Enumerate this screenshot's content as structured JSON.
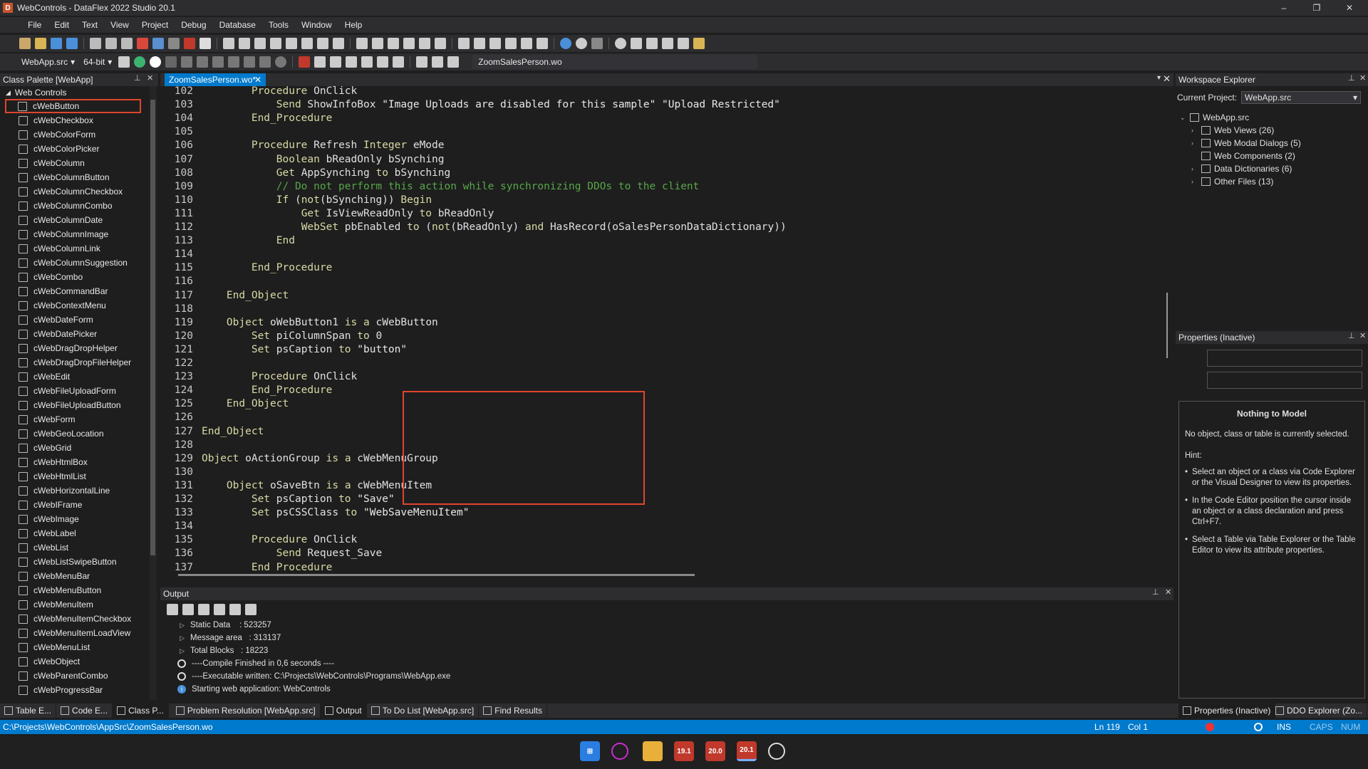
{
  "window": {
    "title": "WebControls - DataFlex 2022 Studio 20.1",
    "controls": [
      "–",
      "❐",
      "✕"
    ]
  },
  "menu": [
    "File",
    "Edit",
    "Text",
    "View",
    "Project",
    "Debug",
    "Database",
    "Tools",
    "Window",
    "Help"
  ],
  "toolbar": {
    "project_combo": "WebApp.src",
    "arch_combo": "64-bit",
    "file_field": "ZoomSalesPerson.wo"
  },
  "class_palette": {
    "title": "Class Palette [WebApp]",
    "root": "Web Controls",
    "items": [
      "cWebButton",
      "cWebCheckbox",
      "cWebColorForm",
      "cWebColorPicker",
      "cWebColumn",
      "cWebColumnButton",
      "cWebColumnCheckbox",
      "cWebColumnCombo",
      "cWebColumnDate",
      "cWebColumnImage",
      "cWebColumnLink",
      "cWebColumnSuggestion",
      "cWebCombo",
      "cWebCommandBar",
      "cWebContextMenu",
      "cWebDateForm",
      "cWebDatePicker",
      "cWebDragDropHelper",
      "cWebDragDropFileHelper",
      "cWebEdit",
      "cWebFileUploadForm",
      "cWebFileUploadButton",
      "cWebForm",
      "cWebGeoLocation",
      "cWebGrid",
      "cWebHtmlBox",
      "cWebHtmlList",
      "cWebHorizontalLine",
      "cWebIFrame",
      "cWebImage",
      "cWebLabel",
      "cWebList",
      "cWebListSwipeButton",
      "cWebMenuBar",
      "cWebMenuButton",
      "cWebMenuItem",
      "cWebMenuItemCheckbox",
      "cWebMenuItemLoadView",
      "cWebMenuList",
      "cWebObject",
      "cWebParentCombo",
      "cWebProgressBar"
    ],
    "selected_index": 0
  },
  "editor": {
    "tab_label": "ZoomSalesPerson.wo*",
    "lines": [
      {
        "n": "102",
        "t": "        Procedure OnClick"
      },
      {
        "n": "103",
        "t": "            Send ShowInfoBox \"Image Uploads are disabled for this sample\" \"Upload Restricted\""
      },
      {
        "n": "104",
        "t": "        End_Procedure"
      },
      {
        "n": "105",
        "t": ""
      },
      {
        "n": "106",
        "t": "        Procedure Refresh Integer eMode"
      },
      {
        "n": "107",
        "t": "            Boolean bReadOnly bSynching"
      },
      {
        "n": "108",
        "t": "            Get AppSynching to bSynching"
      },
      {
        "n": "109",
        "t": "            // Do not perform this action while synchronizing DDOs to the client"
      },
      {
        "n": "110",
        "t": "            If (not(bSynching)) Begin"
      },
      {
        "n": "111",
        "t": "                Get IsViewReadOnly to bReadOnly"
      },
      {
        "n": "112",
        "t": "                WebSet pbEnabled to (not(bReadOnly) and HasRecord(oSalesPersonDataDictionary))"
      },
      {
        "n": "113",
        "t": "            End"
      },
      {
        "n": "114",
        "t": ""
      },
      {
        "n": "115",
        "t": "        End_Procedure"
      },
      {
        "n": "116",
        "t": ""
      },
      {
        "n": "117",
        "t": "    End_Object"
      },
      {
        "n": "118",
        "t": ""
      },
      {
        "n": "119",
        "t": "    Object oWebButton1 is a cWebButton"
      },
      {
        "n": "120",
        "t": "        Set piColumnSpan to 0"
      },
      {
        "n": "121",
        "t": "        Set psCaption to \"button\""
      },
      {
        "n": "122",
        "t": ""
      },
      {
        "n": "123",
        "t": "        Procedure OnClick"
      },
      {
        "n": "124",
        "t": "        End_Procedure"
      },
      {
        "n": "125",
        "t": "    End_Object"
      },
      {
        "n": "126",
        "t": ""
      },
      {
        "n": "127",
        "t": "End_Object"
      },
      {
        "n": "128",
        "t": ""
      },
      {
        "n": "129",
        "t": "Object oActionGroup is a cWebMenuGroup"
      },
      {
        "n": "130",
        "t": ""
      },
      {
        "n": "131",
        "t": "    Object oSaveBtn is a cWebMenuItem"
      },
      {
        "n": "132",
        "t": "        Set psCaption to \"Save\""
      },
      {
        "n": "133",
        "t": "        Set psCSSClass to \"WebSaveMenuItem\""
      },
      {
        "n": "134",
        "t": ""
      },
      {
        "n": "135",
        "t": "        Procedure OnClick"
      },
      {
        "n": "136",
        "t": "            Send Request_Save"
      },
      {
        "n": "137",
        "t": "        End_Procedure"
      }
    ]
  },
  "output": {
    "title": "Output",
    "lines": [
      {
        "kind": "tri",
        "text": "Static Data    : 523257"
      },
      {
        "kind": "tri",
        "text": "Message area   : 313137"
      },
      {
        "kind": "tri",
        "text": "Total Blocks   : 18223"
      },
      {
        "kind": "circle",
        "text": "----Compile Finished in 0,6 seconds ----"
      },
      {
        "kind": "circle",
        "text": "----Executable written: C:\\Projects\\WebControls\\Programs\\WebApp.exe"
      },
      {
        "kind": "info",
        "text": "Starting web application: WebControls"
      }
    ]
  },
  "workspace": {
    "title": "Workspace Explorer",
    "current_project_label": "Current Project:",
    "current_project": "WebApp.src",
    "root": "WebApp.src",
    "nodes": [
      "Web Views (26)",
      "Web Modal Dialogs (5)",
      "Web Components (2)",
      "Data Dictionaries (6)",
      "Other Files (13)"
    ]
  },
  "properties": {
    "title": "Properties (Inactive)",
    "model_title": "Nothing to Model",
    "model_text": "No object, class or table is currently selected.",
    "hint_label": "Hint:",
    "hints": [
      "Select an object or a class via Code Explorer or the Visual Designer to view its properties.",
      "In the Code Editor position the cursor inside an object or a class declaration and press Ctrl+F7.",
      "Select a Table via Table Explorer or the Table Editor to view its attribute properties."
    ]
  },
  "bottom_tabs_left": [
    "Table E...",
    "Code E...",
    "Class P..."
  ],
  "bottom_tabs_mid": [
    "Problem Resolution [WebApp.src]",
    "Output",
    "To Do List [WebApp.src]",
    "Find Results"
  ],
  "bottom_tabs_right": [
    "Properties (Inactive)",
    "DDO Explorer (Zo..."
  ],
  "status": {
    "path": "C:\\Projects\\WebControls\\AppSrc\\ZoomSalesPerson.wo",
    "ln": "Ln 119",
    "col": "Col 1",
    "ins": "INS",
    "caps": "CAPS",
    "num": "NUM"
  },
  "taskbar": {
    "apps": [
      "19.1",
      "20.0",
      "20.1"
    ]
  }
}
